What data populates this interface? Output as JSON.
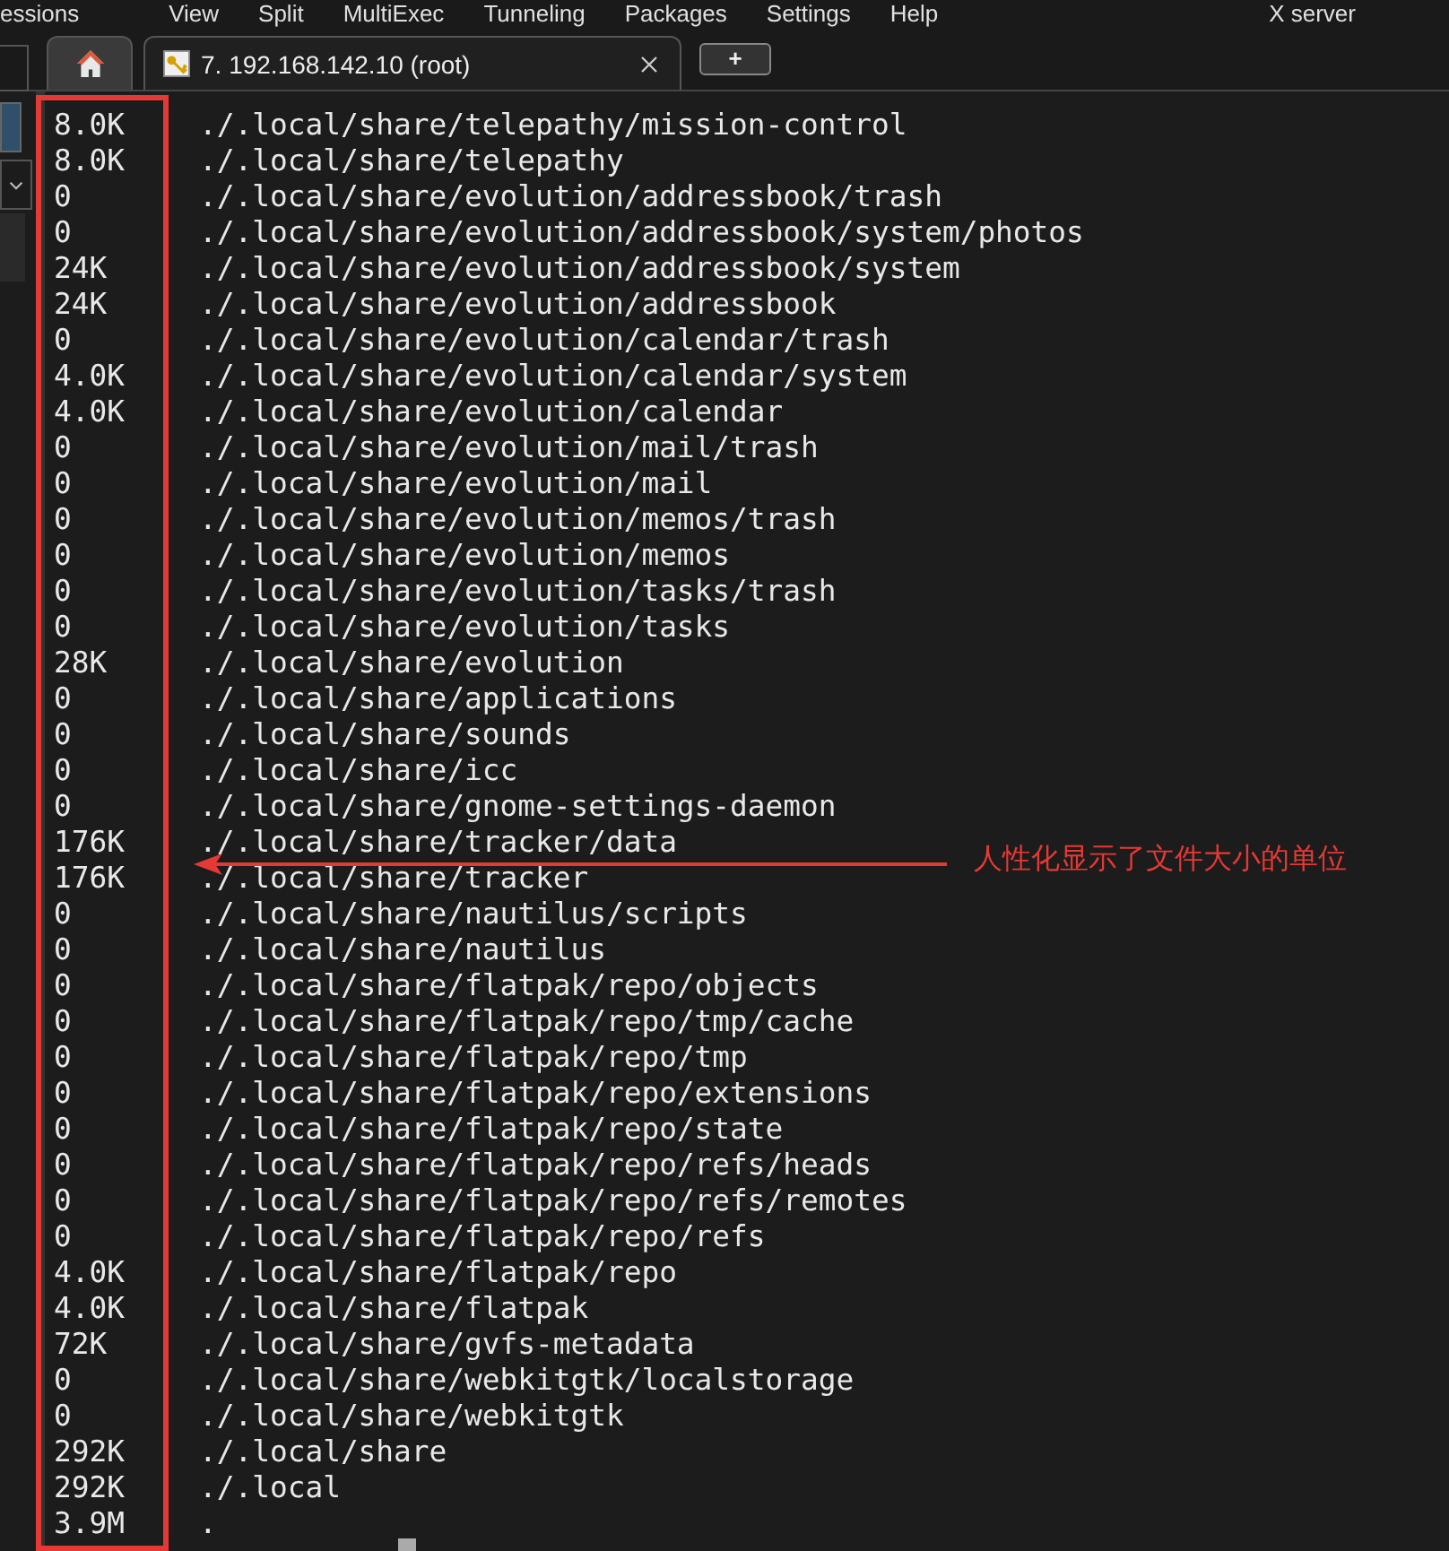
{
  "menu": [
    "essions",
    "View",
    "Split",
    "MultiExec",
    "Tunneling",
    "Packages",
    "Settings",
    "Help",
    "X server"
  ],
  "tabs": [
    {
      "kind": "home",
      "selected": false
    },
    {
      "kind": "session",
      "label": "7. 192.168.142.10 (root)",
      "selected": true
    }
  ],
  "new_tab": "+",
  "rows": [
    {
      "size": "8.0K",
      "path": "./.local/share/telepathy/mission-control"
    },
    {
      "size": "8.0K",
      "path": "./.local/share/telepathy"
    },
    {
      "size": "0",
      "path": "./.local/share/evolution/addressbook/trash"
    },
    {
      "size": "0",
      "path": "./.local/share/evolution/addressbook/system/photos"
    },
    {
      "size": "24K",
      "path": "./.local/share/evolution/addressbook/system"
    },
    {
      "size": "24K",
      "path": "./.local/share/evolution/addressbook"
    },
    {
      "size": "0",
      "path": "./.local/share/evolution/calendar/trash"
    },
    {
      "size": "4.0K",
      "path": "./.local/share/evolution/calendar/system"
    },
    {
      "size": "4.0K",
      "path": "./.local/share/evolution/calendar"
    },
    {
      "size": "0",
      "path": "./.local/share/evolution/mail/trash"
    },
    {
      "size": "0",
      "path": "./.local/share/evolution/mail"
    },
    {
      "size": "0",
      "path": "./.local/share/evolution/memos/trash"
    },
    {
      "size": "0",
      "path": "./.local/share/evolution/memos"
    },
    {
      "size": "0",
      "path": "./.local/share/evolution/tasks/trash"
    },
    {
      "size": "0",
      "path": "./.local/share/evolution/tasks"
    },
    {
      "size": "28K",
      "path": "./.local/share/evolution"
    },
    {
      "size": "0",
      "path": "./.local/share/applications"
    },
    {
      "size": "0",
      "path": "./.local/share/sounds"
    },
    {
      "size": "0",
      "path": "./.local/share/icc"
    },
    {
      "size": "0",
      "path": "./.local/share/gnome-settings-daemon"
    },
    {
      "size": "176K",
      "path": "./.local/share/tracker/data"
    },
    {
      "size": "176K",
      "path": "./.local/share/tracker"
    },
    {
      "size": "0",
      "path": "./.local/share/nautilus/scripts"
    },
    {
      "size": "0",
      "path": "./.local/share/nautilus"
    },
    {
      "size": "0",
      "path": "./.local/share/flatpak/repo/objects"
    },
    {
      "size": "0",
      "path": "./.local/share/flatpak/repo/tmp/cache"
    },
    {
      "size": "0",
      "path": "./.local/share/flatpak/repo/tmp"
    },
    {
      "size": "0",
      "path": "./.local/share/flatpak/repo/extensions"
    },
    {
      "size": "0",
      "path": "./.local/share/flatpak/repo/state"
    },
    {
      "size": "0",
      "path": "./.local/share/flatpak/repo/refs/heads"
    },
    {
      "size": "0",
      "path": "./.local/share/flatpak/repo/refs/remotes"
    },
    {
      "size": "0",
      "path": "./.local/share/flatpak/repo/refs"
    },
    {
      "size": "4.0K",
      "path": "./.local/share/flatpak/repo"
    },
    {
      "size": "4.0K",
      "path": "./.local/share/flatpak"
    },
    {
      "size": "72K",
      "path": "./.local/share/gvfs-metadata"
    },
    {
      "size": "0",
      "path": "./.local/share/webkitgtk/localstorage"
    },
    {
      "size": "0",
      "path": "./.local/share/webkitgtk"
    },
    {
      "size": "292K",
      "path": "./.local/share"
    },
    {
      "size": "292K",
      "path": "./.local"
    },
    {
      "size": "3.9M",
      "path": "."
    }
  ],
  "annotation": "人性化显示了文件大小的单位"
}
